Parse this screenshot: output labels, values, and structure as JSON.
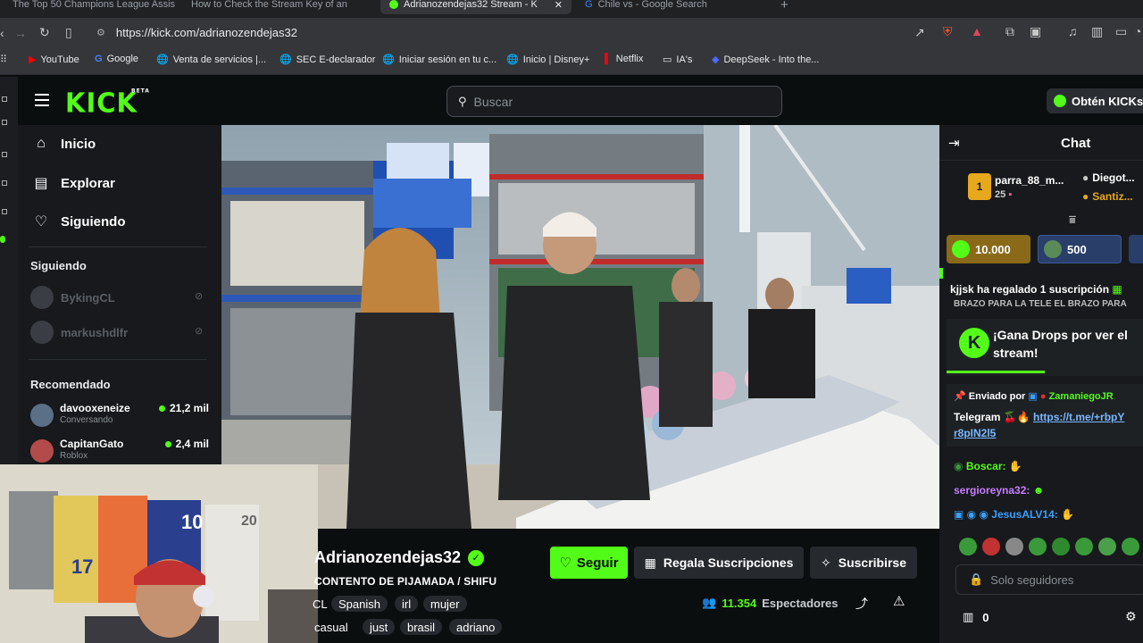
{
  "browser": {
    "tabs": [
      {
        "label": "The Top 50 Champions League Assis"
      },
      {
        "label": "How to Check the Stream Key of an"
      },
      {
        "label": "Adrianozendejas32 Stream - K",
        "active": true
      },
      {
        "label": "Chile vs - Google Search"
      }
    ],
    "url": "https://kick.com/adrianozendejas32",
    "bookmarks": [
      {
        "label": "YouTube"
      },
      {
        "label": "Google"
      },
      {
        "label": "Venta de servicios |..."
      },
      {
        "label": "SEC E-declarador"
      },
      {
        "label": "Iniciar sesión en tu c..."
      },
      {
        "label": "Inicio | Disney+"
      },
      {
        "label": "Netflix"
      },
      {
        "label": "IA's"
      },
      {
        "label": "DeepSeek - Into the..."
      }
    ]
  },
  "kick": {
    "logo": "KICK",
    "logo_badge": "BETA",
    "search_placeholder": "Buscar",
    "kicks_button": "Obtén KICKs",
    "nav": [
      {
        "label": "Inicio",
        "icon": "home-icon"
      },
      {
        "label": "Explorar",
        "icon": "compass-icon"
      },
      {
        "label": "Siguiendo",
        "icon": "heart-icon"
      }
    ],
    "following_title": "Siguiendo",
    "following": [
      {
        "name": "BykingCL"
      },
      {
        "name": "markushdlfr"
      }
    ],
    "recommended_title": "Recomendado",
    "recommended": [
      {
        "name": "davooxeneize",
        "category": "Conversando",
        "viewers": "21,2 mil"
      },
      {
        "name": "CapitanGato",
        "category": "Roblox",
        "viewers": "2,4 mil"
      }
    ]
  },
  "stream": {
    "streamer": "Adrianozendejas32",
    "title": "CONTENTO DE PIJAMADA / SHIFU",
    "tags_row1": [
      "CL",
      "Spanish",
      "irl",
      "mujer"
    ],
    "tags_row2": [
      "casual",
      "just",
      "brasil",
      "adriano"
    ],
    "follow_label": "Seguir",
    "gift_label": "Regala Suscripciones",
    "subscribe_label": "Suscribirse",
    "viewers_count": "11.354",
    "viewers_label": "Espectadores",
    "webcam_shirt_numbers": [
      "10",
      "17",
      "20"
    ]
  },
  "chat": {
    "title": "Chat",
    "podium": [
      {
        "rank": "1",
        "name": "parra_88_m...",
        "count": "25"
      },
      {
        "name": "Diegot..."
      },
      {
        "name": "Santiz..."
      }
    ],
    "pills": [
      {
        "value": "10.000"
      },
      {
        "value": "500"
      }
    ],
    "gift_message": "kjjsk ha regalado 1 suscripción",
    "partial_line": "BRAZO PARA LA TELE EL BRAZO PARA",
    "drops_text": "¡Gana Drops por ver el stream!",
    "pinned_prefix": "Enviado por",
    "pinned_user": "ZamaniegoJR",
    "pinned_text": "Telegram",
    "pinned_link": "https://t.me/+rbpY",
    "pinned_link_cont": "r8pIN2l5",
    "messages": [
      {
        "user": "Boscar:"
      },
      {
        "user": "sergioreyna32:"
      },
      {
        "user": "JesusALV14:"
      }
    ],
    "input_placeholder": "Solo seguidores",
    "kicks_count": "0"
  },
  "colors": {
    "kick_green": "#53fc18",
    "bg": "#0b0e0f",
    "panel": "#17191c"
  }
}
